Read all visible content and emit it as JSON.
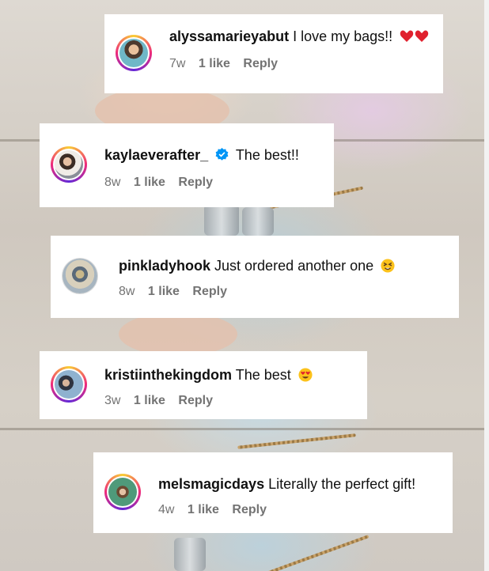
{
  "colors": {
    "card_bg": "#ffffff",
    "username": "#111111",
    "meta": "#737373",
    "verified_badge": "#0095f6",
    "story_ring": [
      "#f9ce34",
      "#ee2a7b",
      "#6228d7"
    ]
  },
  "comments": [
    {
      "username": "alyssamarieyabut",
      "verified": false,
      "text": "I love my bags!!",
      "emoji": "two red hearts",
      "time": "7w",
      "likes": "1 like",
      "reply": "Reply",
      "avatar_ring": true
    },
    {
      "username": "kaylaeverafter_",
      "verified": true,
      "text": "The best!!",
      "emoji": "",
      "time": "8w",
      "likes": "1 like",
      "reply": "Reply",
      "avatar_ring": true
    },
    {
      "username": "pinkladyhook",
      "verified": false,
      "text": "Just ordered another one",
      "emoji": "squinting face",
      "time": "8w",
      "likes": "1 like",
      "reply": "Reply",
      "avatar_ring": false
    },
    {
      "username": "kristiinthekingdom",
      "verified": false,
      "text": "The best",
      "emoji": "heart eyes face",
      "time": "3w",
      "likes": "1 like",
      "reply": "Reply",
      "avatar_ring": true
    },
    {
      "username": "melsmagicdays",
      "verified": false,
      "text": "Literally the perfect gift!",
      "emoji": "",
      "time": "4w",
      "likes": "1 like",
      "reply": "Reply",
      "avatar_ring": true
    }
  ]
}
